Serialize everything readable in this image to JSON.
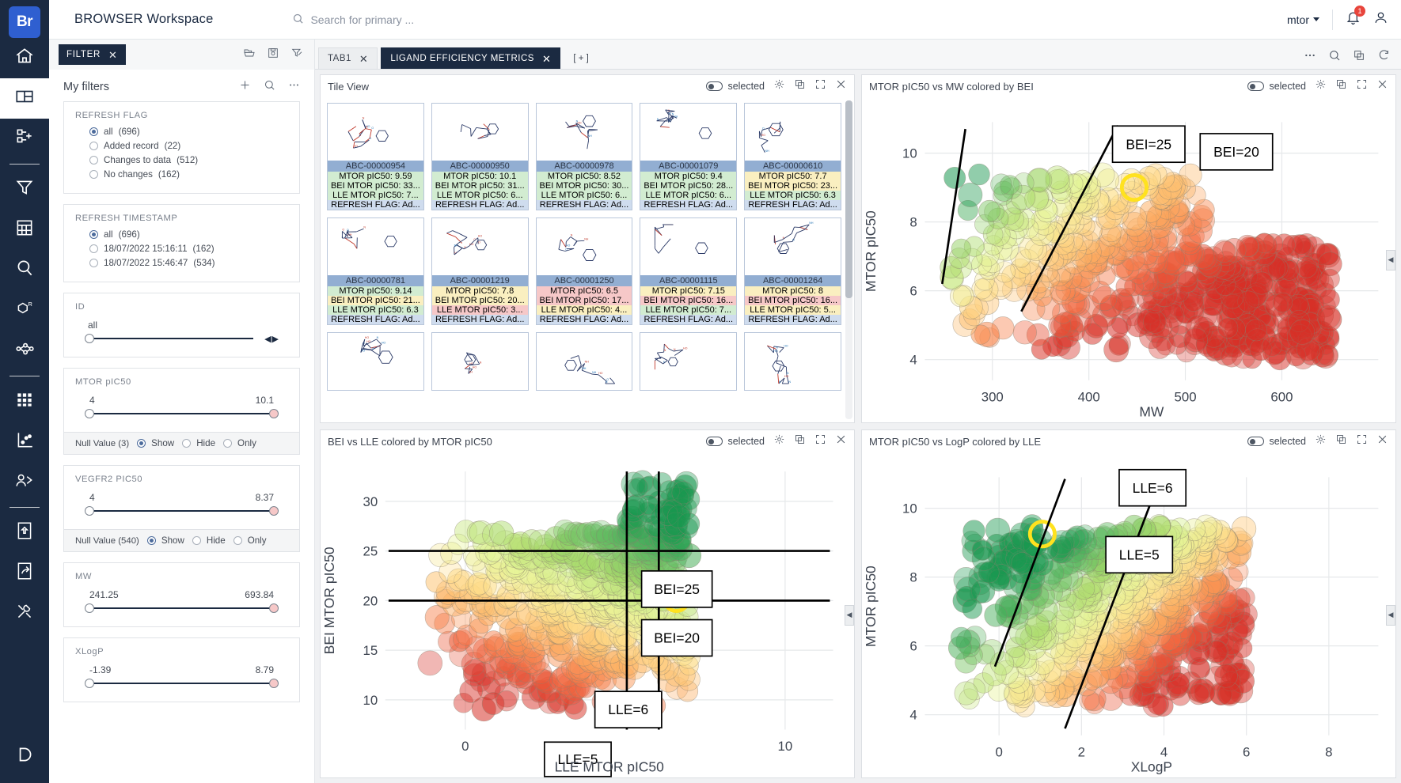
{
  "app": {
    "logo": "Br",
    "workspace_title": "BROWSER Workspace",
    "search_placeholder": "Search for primary ...",
    "user": "mtor",
    "notification_count": "1"
  },
  "rail": {
    "items": [
      {
        "name": "home-icon",
        "label": "Home"
      },
      {
        "name": "layout-icon",
        "label": "Workspace"
      },
      {
        "name": "add-node-icon",
        "label": "Add"
      },
      {
        "name": "filter-icon",
        "label": "Filter"
      },
      {
        "name": "table-icon",
        "label": "Table"
      },
      {
        "name": "search-icon",
        "label": "Search"
      },
      {
        "name": "rgroup-icon",
        "label": "R-Group"
      },
      {
        "name": "network-icon",
        "label": "Network"
      },
      {
        "name": "grid-icon",
        "label": "Grid"
      },
      {
        "name": "scatter-icon",
        "label": "Scatter"
      },
      {
        "name": "team-icon",
        "label": "Team"
      },
      {
        "name": "upload-icon",
        "label": "Upload"
      },
      {
        "name": "export-icon",
        "label": "Export"
      },
      {
        "name": "tools-icon",
        "label": "Tools"
      }
    ]
  },
  "filter_panel": {
    "tab_label": "FILTER",
    "my_filters_title": "My filters",
    "head_icons": [
      "folder-open-icon",
      "save-icon",
      "clear-filter-icon"
    ],
    "title_icons": [
      "plus-icon",
      "search-icon",
      "more-icon"
    ],
    "cards": [
      {
        "name": "refresh-flag",
        "label": "REFRESH FLAG",
        "type": "radio",
        "options": [
          {
            "label": "all",
            "count": "(696)",
            "selected": true
          },
          {
            "label": "Added record",
            "count": "(22)",
            "selected": false
          },
          {
            "label": "Changes to data",
            "count": "(512)",
            "selected": false
          },
          {
            "label": "No changes",
            "count": "(162)",
            "selected": false
          }
        ]
      },
      {
        "name": "refresh-timestamp",
        "label": "REFRESH TIMESTAMP",
        "type": "radio",
        "options": [
          {
            "label": "all",
            "count": "(696)",
            "selected": true
          },
          {
            "label": "18/07/2022 15:16:11",
            "count": "(162)",
            "selected": false
          },
          {
            "label": "18/07/2022 15:46:47",
            "count": "(534)",
            "selected": false
          }
        ]
      },
      {
        "name": "id",
        "label": "ID",
        "type": "slider-single",
        "min_label": "all",
        "max_label": "",
        "has_arrows": true
      },
      {
        "name": "mtor-pic50",
        "label": "MTOR pIC50",
        "type": "slider",
        "min_label": "4",
        "max_label": "10.1",
        "null_label": "Null Value (3)",
        "null_options": [
          "Show",
          "Hide",
          "Only"
        ],
        "null_selected": "Show"
      },
      {
        "name": "vegfr2-pic50",
        "label": "VEGFR2 PIC50",
        "type": "slider",
        "min_label": "4",
        "max_label": "8.37",
        "null_label": "Null Value (540)",
        "null_options": [
          "Show",
          "Hide",
          "Only"
        ],
        "null_selected": "Show"
      },
      {
        "name": "mw",
        "label": "MW",
        "type": "slider",
        "min_label": "241.25",
        "max_label": "693.84"
      },
      {
        "name": "xlogp",
        "label": "XLogP",
        "type": "slider",
        "min_label": "-1.39",
        "max_label": "8.79"
      }
    ]
  },
  "tabs": {
    "items": [
      {
        "label": "TAB1",
        "active": false
      },
      {
        "label": "LIGAND EFFICIENCY METRICS",
        "active": true
      }
    ],
    "add_label": "[ + ]",
    "icons": [
      "more-icon",
      "zoom-icon",
      "copy-icon",
      "refresh-icon"
    ]
  },
  "panels": {
    "tile_view": {
      "title": "Tile View",
      "selected_label": "selected",
      "tools": [
        "gear-icon",
        "copy-icon",
        "expand-icon",
        "close-icon"
      ]
    },
    "scatter_mw": {
      "title": "MTOR pIC50 vs MW colored by BEI",
      "selected_label": "selected",
      "tools": [
        "gear-icon",
        "copy-icon",
        "expand-icon",
        "close-icon"
      ]
    },
    "scatter_bei_lle": {
      "title": "BEI vs LLE colored by MTOR pIC50",
      "selected_label": "selected",
      "tools": [
        "gear-icon",
        "copy-icon",
        "expand-icon",
        "close-icon"
      ]
    },
    "scatter_logp": {
      "title": "MTOR pIC50 vs LogP colored by LLE",
      "selected_label": "selected",
      "tools": [
        "gear-icon",
        "copy-icon",
        "expand-icon",
        "close-icon"
      ]
    }
  },
  "tiles": [
    {
      "id": "ABC-00000954",
      "lines": [
        {
          "text": "MTOR pIC50: 9.59",
          "color": "g"
        },
        {
          "text": "BEI MTOR pIC50: 33...",
          "color": "g"
        },
        {
          "text": "LLE MTOR pIC50: 7...",
          "color": "g"
        },
        {
          "text": "REFRESH FLAG: Ad...",
          "color": "b"
        }
      ]
    },
    {
      "id": "ABC-00000950",
      "lines": [
        {
          "text": "MTOR pIC50: 10.1",
          "color": "g"
        },
        {
          "text": "BEI MTOR pIC50: 31...",
          "color": "g"
        },
        {
          "text": "LLE MTOR pIC50: 6...",
          "color": "g"
        },
        {
          "text": "REFRESH FLAG: Ad...",
          "color": "b"
        }
      ]
    },
    {
      "id": "ABC-00000978",
      "lines": [
        {
          "text": "MTOR pIC50: 8.52",
          "color": "g"
        },
        {
          "text": "BEI MTOR pIC50: 30...",
          "color": "g"
        },
        {
          "text": "LLE MTOR pIC50: 6...",
          "color": "g"
        },
        {
          "text": "REFRESH FLAG: Ad...",
          "color": "b"
        }
      ]
    },
    {
      "id": "ABC-00001079",
      "lines": [
        {
          "text": "MTOR pIC50: 9.4",
          "color": "g"
        },
        {
          "text": "BEI MTOR pIC50: 28...",
          "color": "g"
        },
        {
          "text": "LLE MTOR pIC50: 6...",
          "color": "g"
        },
        {
          "text": "REFRESH FLAG: Ad...",
          "color": "b"
        }
      ]
    },
    {
      "id": "ABC-00000610",
      "lines": [
        {
          "text": "MTOR pIC50: 7.7",
          "color": "y"
        },
        {
          "text": "BEI MTOR pIC50: 23...",
          "color": "y"
        },
        {
          "text": "LLE MTOR pIC50: 6.3",
          "color": "g"
        },
        {
          "text": "REFRESH FLAG: Ad...",
          "color": "b"
        }
      ]
    },
    {
      "id": "ABC-00000781",
      "lines": [
        {
          "text": "MTOR pIC50: 9.14",
          "color": "g"
        },
        {
          "text": "BEI MTOR pIC50: 21...",
          "color": "y"
        },
        {
          "text": "LLE MTOR pIC50: 6.3",
          "color": "g"
        },
        {
          "text": "REFRESH FLAG: Ad...",
          "color": "b"
        }
      ]
    },
    {
      "id": "ABC-00001219",
      "lines": [
        {
          "text": "MTOR pIC50: 7.8",
          "color": "y"
        },
        {
          "text": "BEI MTOR pIC50: 20...",
          "color": "y"
        },
        {
          "text": "LLE MTOR pIC50: 3...",
          "color": "r"
        },
        {
          "text": "REFRESH FLAG: Ad...",
          "color": "b"
        }
      ]
    },
    {
      "id": "ABC-00001250",
      "lines": [
        {
          "text": "MTOR pIC50: 6.5",
          "color": "r"
        },
        {
          "text": "BEI MTOR pIC50: 17...",
          "color": "r"
        },
        {
          "text": "LLE MTOR pIC50: 4...",
          "color": "y"
        },
        {
          "text": "REFRESH FLAG: Ad...",
          "color": "b"
        }
      ]
    },
    {
      "id": "ABC-00001115",
      "lines": [
        {
          "text": "MTOR pIC50: 7.15",
          "color": "y"
        },
        {
          "text": "BEI MTOR pIC50: 16...",
          "color": "r"
        },
        {
          "text": "LLE MTOR pIC50: 7...",
          "color": "g"
        },
        {
          "text": "REFRESH FLAG: Ad...",
          "color": "b"
        }
      ]
    },
    {
      "id": "ABC-00001264",
      "lines": [
        {
          "text": "MTOR pIC50: 8",
          "color": "y"
        },
        {
          "text": "BEI MTOR pIC50: 16...",
          "color": "r"
        },
        {
          "text": "LLE MTOR pIC50: 5...",
          "color": "y"
        },
        {
          "text": "REFRESH FLAG: Ad...",
          "color": "b"
        }
      ]
    }
  ],
  "chart_data": [
    {
      "id": "scatter_mw",
      "type": "scatter",
      "title": "MTOR pIC50 vs MW colored by BEI",
      "xlabel": "MW",
      "ylabel": "MTOR pIC50",
      "xticks": [
        300,
        400,
        500,
        600
      ],
      "yticks": [
        4,
        6,
        8,
        10
      ],
      "xlim": [
        230,
        700
      ],
      "ylim": [
        3.4,
        10.9
      ],
      "color_by": "BEI",
      "annotations": [
        {
          "text": "BEI=25",
          "x": 370,
          "y": 10.2
        },
        {
          "text": "BEI=20",
          "x": 455,
          "y": 10.0
        }
      ],
      "reference_lines": [
        "BEI=25",
        "BEI=20"
      ],
      "grid": true,
      "legend": "none"
    },
    {
      "id": "scatter_bei_lle",
      "type": "scatter",
      "title": "BEI vs LLE colored by MTOR pIC50",
      "xlabel": "LLE MTOR pIC50",
      "ylabel": "BEI MTOR pIC50",
      "xticks": [
        0,
        10
      ],
      "yticks": [
        10,
        15,
        20,
        25,
        30
      ],
      "xlim": [
        -2.5,
        11.5
      ],
      "ylim": [
        7,
        33
      ],
      "color_by": "MTOR pIC50",
      "annotations": [
        {
          "text": "BEI=25",
          "x": 7.5,
          "y": 25
        },
        {
          "text": "BEI=20",
          "x": 7.5,
          "y": 20
        },
        {
          "text": "LLE=6",
          "x": 6.0,
          "y": 13
        },
        {
          "text": "LLE=5",
          "x": 5.0,
          "y": 9
        }
      ],
      "reference_lines": [
        "BEI=25",
        "BEI=20",
        "LLE=6",
        "LLE=5"
      ],
      "grid": true,
      "legend": "none"
    },
    {
      "id": "scatter_logp",
      "type": "scatter",
      "title": "MTOR pIC50 vs LogP colored by LLE",
      "xlabel": "XLogP",
      "ylabel": "MTOR pIC50",
      "xticks": [
        0,
        2,
        4,
        6,
        8
      ],
      "yticks": [
        4,
        6,
        8,
        10
      ],
      "xlim": [
        -1.8,
        9.2
      ],
      "ylim": [
        3.4,
        10.9
      ],
      "color_by": "LLE",
      "annotations": [
        {
          "text": "LLE=6",
          "x": 3.2,
          "y": 9.6
        },
        {
          "text": "LLE=5",
          "x": 3.0,
          "y": 7.6
        }
      ],
      "reference_lines": [
        "LLE=6",
        "LLE=5"
      ],
      "grid": true,
      "legend": "none"
    }
  ]
}
